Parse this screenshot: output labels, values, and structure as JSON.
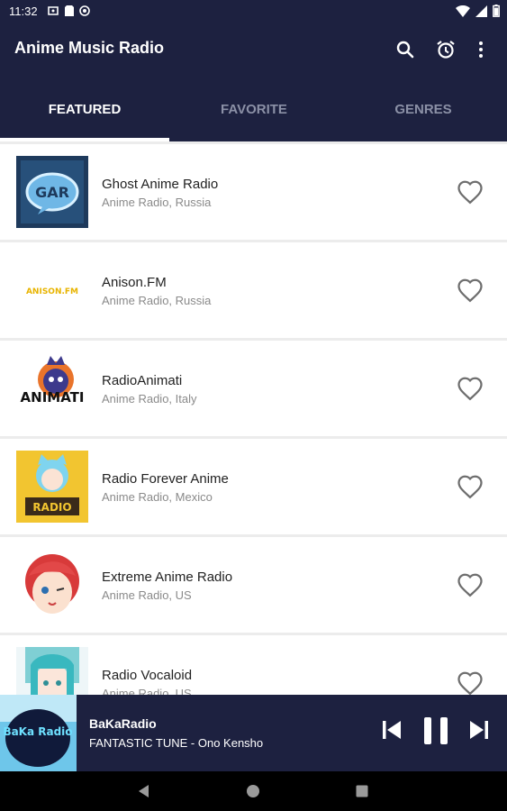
{
  "status_bar": {
    "time": "11:32"
  },
  "app_bar": {
    "title": "Anime Music Radio",
    "actions": [
      "search-icon",
      "alarm-icon",
      "more-vert-icon"
    ]
  },
  "tabs": [
    {
      "label": "FEATURED",
      "active": true
    },
    {
      "label": "FAVORITE",
      "active": false
    },
    {
      "label": "GENRES",
      "active": false
    }
  ],
  "stations": [
    {
      "name": "Ghost Anime Radio",
      "subtitle": "Anime Radio, Russia",
      "logo_text": "GAR"
    },
    {
      "name": "Anison.FM",
      "subtitle": "Anime Radio, Russia",
      "logo_text": "ANISON.FM"
    },
    {
      "name": "RadioAnimati",
      "subtitle": "Anime Radio, Italy",
      "logo_text": "ANIMATI"
    },
    {
      "name": "Radio Forever Anime",
      "subtitle": "Anime Radio, Mexico",
      "logo_text": "RADIO"
    },
    {
      "name": "Extreme Anime Radio",
      "subtitle": "Anime Radio, US",
      "logo_text": ""
    },
    {
      "name": "Radio Vocaloid",
      "subtitle": "Anime Radio, US",
      "logo_text": ""
    }
  ],
  "player": {
    "station": "BaKaRadio",
    "track": "FANTASTIC TUNE - Ono Kensho",
    "art_text": "BaKa Radio"
  },
  "colors": {
    "primary": "#1d2140",
    "tab_inactive": "#8b90a6",
    "heart": "#6e6e6e"
  }
}
